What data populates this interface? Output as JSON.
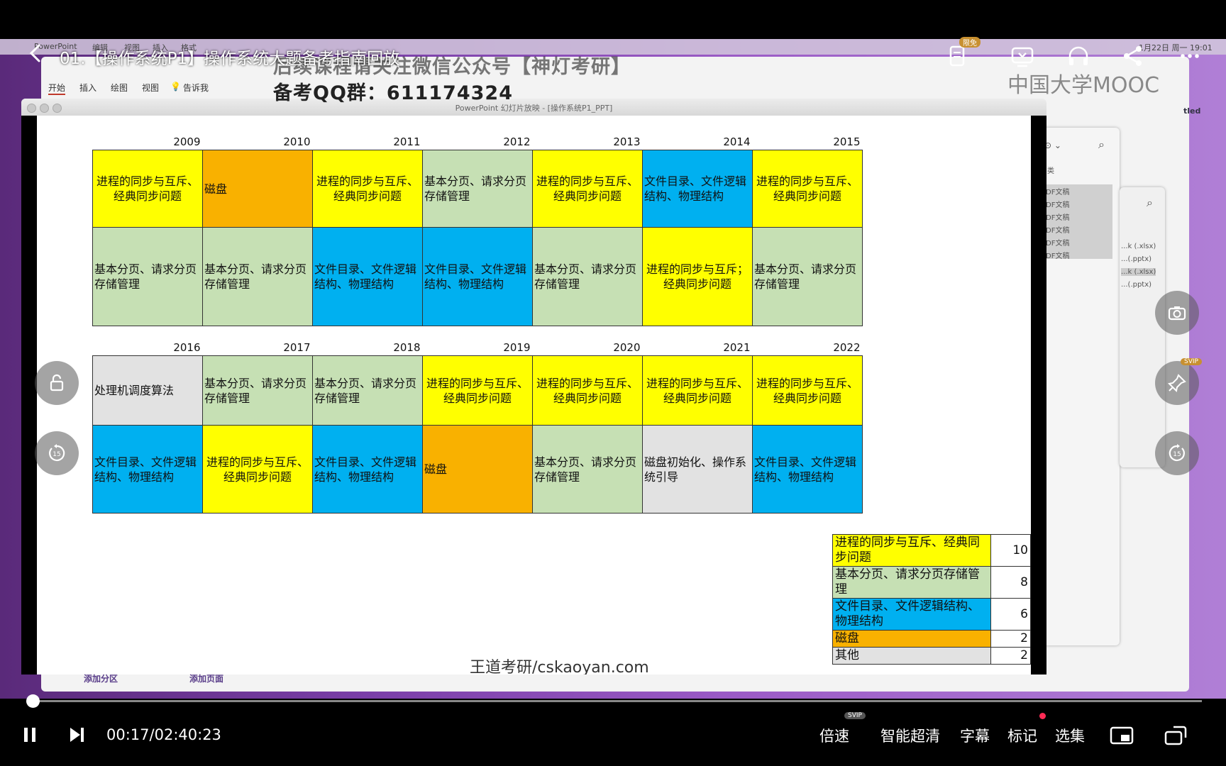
{
  "player": {
    "title": "01.【操作系统P1】操作系统大题备考指南回放",
    "limited_free_badge": "限免",
    "current_time": "00:17",
    "total_time": "02:40:23",
    "time_display": "00:17/02:40:23",
    "speed_label": "倍速",
    "quality_label": "智能超清",
    "subtitle_label": "字幕",
    "mark_label": "标记",
    "episodes_label": "选集",
    "svip_badge": "SVIP",
    "rewind_seconds": "15",
    "forward_seconds": "15",
    "progress_fraction": 0.0018
  },
  "desktop": {
    "menubar_app": "PowerPoint",
    "menubar_items": [
      "编辑",
      "视图",
      "插入",
      "格式"
    ],
    "menubar_datetime": "1月22日 周一 19:01",
    "mooc_logo": "中国大学MOOC",
    "side_label": "tled"
  },
  "powerpoint": {
    "ribbon_tabs": [
      "开始",
      "插入",
      "绘图",
      "视图"
    ],
    "ribbon_tell_me": "告诉我",
    "slideshow_title": "PowerPoint 幻灯片放映 - [操作系统P1_PPT]",
    "add_section": "添加分区",
    "add_page": "添加页面"
  },
  "finder_panel": {
    "items": [
      "DF文稿",
      "DF文稿",
      "DF文稿",
      "DF文稿",
      "DF文稿",
      "DF文稿"
    ],
    "header_label": "类"
  },
  "finder_panel2": {
    "items": [
      "...k (.xlsx)",
      "...(.pptx)",
      "...k (.xlsx)",
      "...(.pptx)"
    ]
  },
  "overlay": {
    "line1": "后续课程请关注微信公众号【神灯考研】",
    "line2": "备考QQ群：611174324"
  },
  "slide": {
    "watermark": "王道考研/cskaoyan.com",
    "block1": {
      "years": [
        "2009",
        "2010",
        "2011",
        "2012",
        "2013",
        "2014",
        "2015"
      ],
      "row1": [
        {
          "text": "进程的同步与互斥、经典同步问题",
          "color": "yellow"
        },
        {
          "text": "磁盘",
          "color": "orange"
        },
        {
          "text": "进程的同步与互斥、经典同步问题",
          "color": "yellow"
        },
        {
          "text": "基本分页、请求分页存储管理",
          "color": "green"
        },
        {
          "text": "进程的同步与互斥、经典同步问题",
          "color": "yellow"
        },
        {
          "text": "文件目录、文件逻辑结构、物理结构",
          "color": "blue"
        },
        {
          "text": "进程的同步与互斥、经典同步问题",
          "color": "yellow"
        }
      ],
      "row2": [
        {
          "text": "基本分页、请求分页存储管理",
          "color": "green"
        },
        {
          "text": "基本分页、请求分页存储管理",
          "color": "green"
        },
        {
          "text": "文件目录、文件逻辑结构、物理结构",
          "color": "blue"
        },
        {
          "text": "文件目录、文件逻辑结构、物理结构",
          "color": "blue"
        },
        {
          "text": "基本分页、请求分页存储管理",
          "color": "green"
        },
        {
          "text": "进程的同步与互斥；经典同步问题",
          "color": "yellow"
        },
        {
          "text": "基本分页、请求分页存储管理",
          "color": "green"
        }
      ]
    },
    "block2": {
      "years": [
        "2016",
        "2017",
        "2018",
        "2019",
        "2020",
        "2021",
        "2022"
      ],
      "row1": [
        {
          "text": "处理机调度算法",
          "color": "grey"
        },
        {
          "text": "基本分页、请求分页存储管理",
          "color": "green"
        },
        {
          "text": "基本分页、请求分页存储管理",
          "color": "green"
        },
        {
          "text": "进程的同步与互斥、经典同步问题",
          "color": "yellow"
        },
        {
          "text": "进程的同步与互斥、经典同步问题",
          "color": "yellow"
        },
        {
          "text": "进程的同步与互斥、经典同步问题",
          "color": "yellow"
        },
        {
          "text": "进程的同步与互斥、经典同步问题",
          "color": "yellow"
        }
      ],
      "row2": [
        {
          "text": "文件目录、文件逻辑结构、物理结构",
          "color": "blue"
        },
        {
          "text": "进程的同步与互斥、经典同步问题",
          "color": "yellow"
        },
        {
          "text": "文件目录、文件逻辑结构、物理结构",
          "color": "blue"
        },
        {
          "text": "磁盘",
          "color": "orange"
        },
        {
          "text": "基本分页、请求分页存储管理",
          "color": "green"
        },
        {
          "text": "磁盘初始化、操作系统引导",
          "color": "grey"
        },
        {
          "text": "文件目录、文件逻辑结构、物理结构",
          "color": "blue"
        }
      ]
    },
    "summary": [
      {
        "label": "进程的同步与互斥、经典同步问题",
        "count": "10",
        "color": "yellow"
      },
      {
        "label": "基本分页、请求分页存储管理",
        "count": "8",
        "color": "green"
      },
      {
        "label": "文件目录、文件逻辑结构、物理结构",
        "count": "6",
        "color": "blue"
      },
      {
        "label": "磁盘",
        "count": "2",
        "color": "orange"
      },
      {
        "label": "其他",
        "count": "2",
        "color": "grey"
      }
    ]
  },
  "colors": {
    "yellow": "#ffff00",
    "orange": "#f9b100",
    "green": "#c6e0b4",
    "blue": "#00b0f0",
    "grey": "#e2e2e2"
  }
}
